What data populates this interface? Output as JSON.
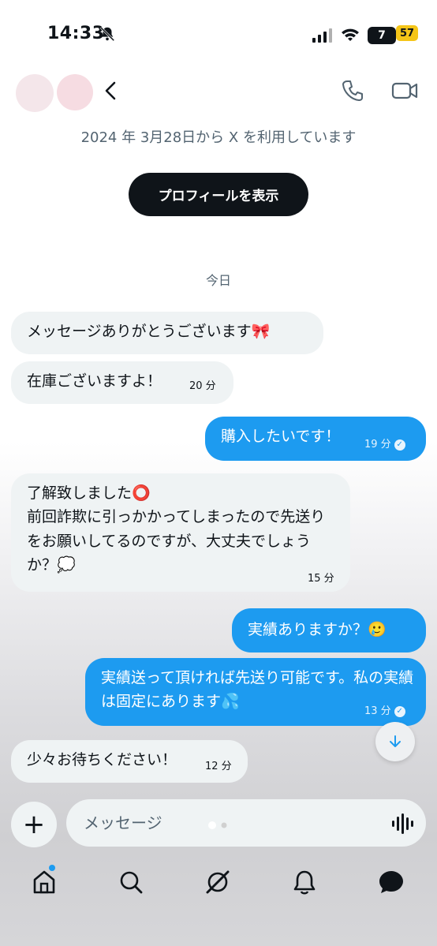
{
  "status_bar": {
    "time": "14:33",
    "carrier_badge": "7",
    "battery": "57"
  },
  "header": {
    "back_label": "<"
  },
  "profile": {
    "joined_text": "2024 年 3月28日から X を利用しています",
    "view_profile_button": "プロフィールを表示"
  },
  "date_divider": "今日",
  "messages": [
    {
      "dir": "recv",
      "text": "メッセージありがとうございます🎀",
      "time": ""
    },
    {
      "dir": "recv",
      "text": "在庫ございますよ！",
      "time": "20 分"
    },
    {
      "dir": "sent",
      "text": "購入したいです！",
      "time": "19 分"
    },
    {
      "dir": "recv",
      "text": "了解致しました⭕\n前回詐欺に引っかかってしまったので先送りをお願いしてるのですが、大丈夫でしょうか？💭",
      "time": "15 分"
    },
    {
      "dir": "sent",
      "text": "実績ありますか？🥲",
      "time": ""
    },
    {
      "dir": "sent",
      "text": "実績送って頂ければ先送り可能です。私の実績は固定にあります💦",
      "time": "13 分"
    },
    {
      "dir": "recv",
      "text": "少々お待ちください！",
      "time": "12 分"
    }
  ],
  "composer": {
    "placeholder": "メッセージ",
    "plus_label": "+"
  },
  "colors": {
    "accent": "#1d9bf0",
    "received_bubble": "#eff3f4",
    "dark_button": "#0f1419"
  }
}
